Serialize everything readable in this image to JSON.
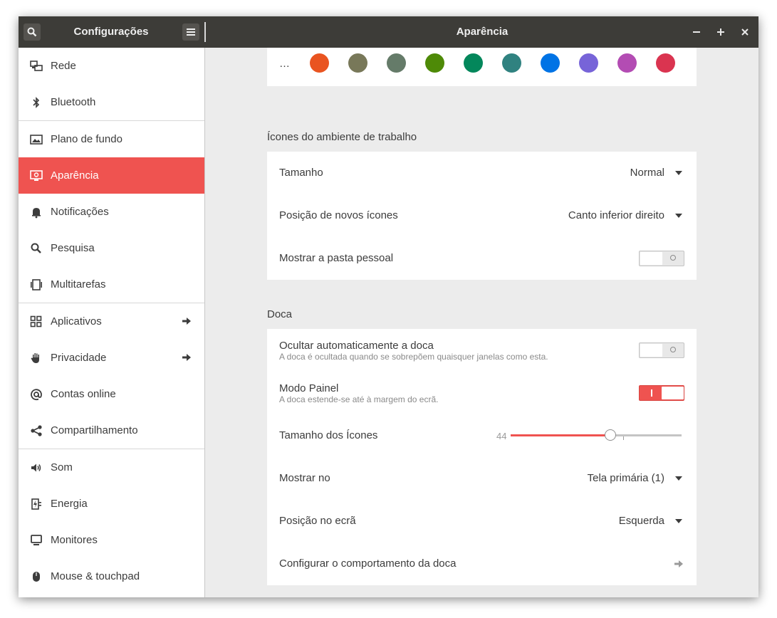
{
  "window": {
    "sidebar_title": "Configurações",
    "title": "Aparência"
  },
  "sidebar": {
    "items": [
      {
        "label": "Rede",
        "icon": "network-icon"
      },
      {
        "label": "Bluetooth",
        "icon": "bluetooth-icon"
      },
      {
        "label": "Plano de fundo",
        "icon": "wallpaper-icon"
      },
      {
        "label": "Aparência",
        "icon": "appearance-icon",
        "active": true
      },
      {
        "label": "Notificações",
        "icon": "bell-icon"
      },
      {
        "label": "Pesquisa",
        "icon": "search-icon"
      },
      {
        "label": "Multitarefas",
        "icon": "multitasking-icon"
      },
      {
        "label": "Aplicativos",
        "icon": "apps-grid-icon",
        "has_arrow": true
      },
      {
        "label": "Privacidade",
        "icon": "hand-icon",
        "has_arrow": true
      },
      {
        "label": "Contas online",
        "icon": "at-icon"
      },
      {
        "label": "Compartilhamento",
        "icon": "share-icon"
      },
      {
        "label": "Som",
        "icon": "speaker-icon"
      },
      {
        "label": "Energia",
        "icon": "power-plug-icon"
      },
      {
        "label": "Monitores",
        "icon": "monitor-icon"
      },
      {
        "label": "Mouse & touchpad",
        "icon": "mouse-icon"
      }
    ]
  },
  "accent_colors": {
    "more_label": "…",
    "colors": [
      "#e95420",
      "#787859",
      "#657b69",
      "#4e8a07",
      "#03875b",
      "#308280",
      "#0073e5",
      "#7764d8",
      "#b34cb3",
      "#da3450"
    ]
  },
  "desktop_icons": {
    "section_title": "Ícones do ambiente de trabalho",
    "size_label": "Tamanho",
    "size_value": "Normal",
    "position_label": "Posição de novos ícones",
    "position_value": "Canto inferior direito",
    "show_home_label": "Mostrar a pasta pessoal",
    "show_home_on": false
  },
  "dock": {
    "section_title": "Doca",
    "autohide_label": "Ocultar automaticamente a doca",
    "autohide_sub": "A doca é ocultada quando se sobrepõem quaisquer janelas como esta.",
    "autohide_on": false,
    "panel_mode_label": "Modo Painel",
    "panel_mode_sub": "A doca estende-se até à margem do ecrã.",
    "panel_mode_on": true,
    "icon_size_label": "Tamanho dos Ícones",
    "icon_size_value": "44",
    "icon_size_min": 16,
    "icon_size_max": 64,
    "show_on_label": "Mostrar no",
    "show_on_value": "Tela primária (1)",
    "screen_position_label": "Posição no ecrã",
    "screen_position_value": "Esquerda",
    "configure_label": "Configurar o comportamento da doca"
  },
  "colors": {
    "accent": "#ef5350",
    "titlebar": "#3d3c38"
  }
}
